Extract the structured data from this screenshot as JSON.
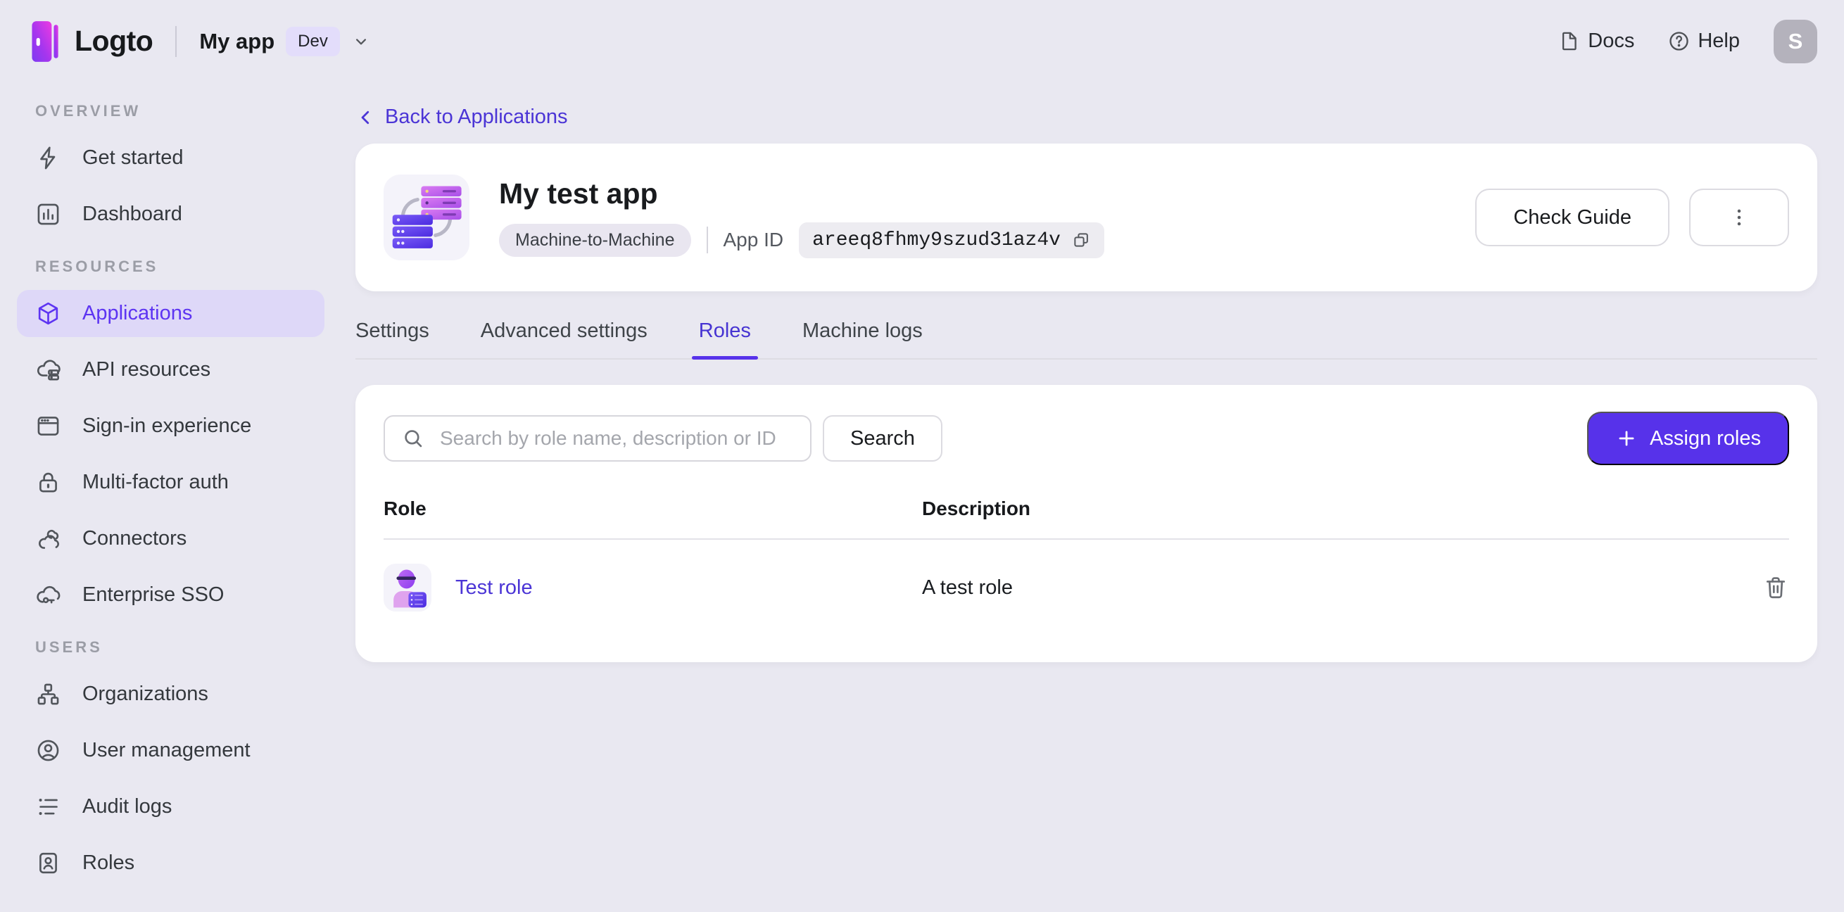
{
  "topbar": {
    "brand": "Logto",
    "logo_icon": "logto-logo-icon",
    "app_switcher": {
      "name": "My app",
      "env_badge": "Dev",
      "chevron_icon": "chevron-down-icon"
    },
    "docs_label": "Docs",
    "docs_icon": "document-icon",
    "help_label": "Help",
    "help_icon": "help-circle-icon",
    "avatar_initial": "S"
  },
  "sidebar": {
    "sections": [
      {
        "label": "OVERVIEW",
        "items": [
          {
            "label": "Get started",
            "icon": "bolt-icon",
            "active": false
          },
          {
            "label": "Dashboard",
            "icon": "bar-chart-icon",
            "active": false
          }
        ]
      },
      {
        "label": "RESOURCES",
        "items": [
          {
            "label": "Applications",
            "icon": "cube-icon",
            "active": true
          },
          {
            "label": "API resources",
            "icon": "cloud-server-icon",
            "active": false
          },
          {
            "label": "Sign-in experience",
            "icon": "browser-icon",
            "active": false
          },
          {
            "label": "Multi-factor auth",
            "icon": "lock-icon",
            "active": false
          },
          {
            "label": "Connectors",
            "icon": "clouds-icon",
            "active": false
          },
          {
            "label": "Enterprise SSO",
            "icon": "cloud-key-icon",
            "active": false
          }
        ]
      },
      {
        "label": "USERS",
        "items": [
          {
            "label": "Organizations",
            "icon": "org-chart-icon",
            "active": false
          },
          {
            "label": "User management",
            "icon": "user-circle-icon",
            "active": false
          },
          {
            "label": "Audit logs",
            "icon": "audit-list-icon",
            "active": false
          },
          {
            "label": "Roles",
            "icon": "id-card-icon",
            "active": false
          }
        ]
      }
    ]
  },
  "main": {
    "back_link": "Back to Applications",
    "back_icon": "chevron-left-icon",
    "app_header": {
      "title": "My test app",
      "type_badge": "Machine-to-Machine",
      "app_id_label": "App ID",
      "app_id_value": "areeq8fhmy9szud31az4v",
      "copy_icon": "copy-icon",
      "check_guide_label": "Check Guide",
      "more_icon": "kebab-menu-icon"
    },
    "tabs": [
      {
        "label": "Settings",
        "active": false
      },
      {
        "label": "Advanced settings",
        "active": false
      },
      {
        "label": "Roles",
        "active": true
      },
      {
        "label": "Machine logs",
        "active": false
      }
    ],
    "roles_panel": {
      "search_placeholder": "Search by role name, description or ID",
      "search_icon": "search-icon",
      "search_button_label": "Search",
      "assign_button_label": "Assign roles",
      "assign_button_icon": "plus-icon",
      "table": {
        "columns": [
          "Role",
          "Description"
        ],
        "rows": [
          {
            "name": "Test role",
            "description": "A test role",
            "action_icon": "trash-icon"
          }
        ]
      }
    }
  },
  "colors": {
    "page_bg": "#e9e8f1",
    "card_bg": "#ffffff",
    "accent": "#5732ea",
    "accent_text": "#5d34f2",
    "active_item_bg": "#ded8f8",
    "link": "#4b35d6"
  }
}
